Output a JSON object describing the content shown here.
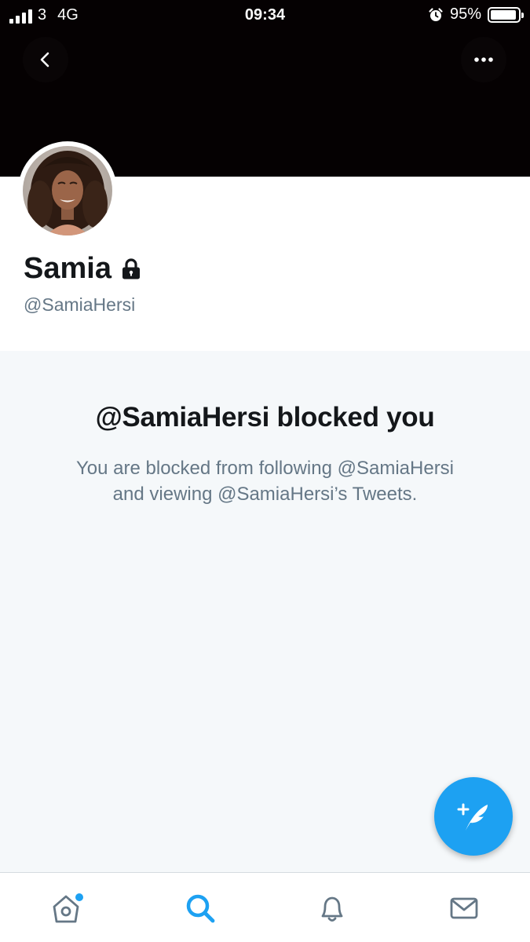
{
  "status_bar": {
    "carrier": "3",
    "network": "4G",
    "time": "09:34",
    "battery_percent": "95%",
    "battery_level": 0.95,
    "icons": [
      "signal-icon",
      "alarm-icon",
      "battery-icon"
    ]
  },
  "header": {
    "back_icon": "chevron-left-icon",
    "more_icon": "more-horizontal-icon"
  },
  "profile": {
    "name": "Samia",
    "handle": "@SamiaHersi",
    "protected_icon": "lock-icon"
  },
  "blocked_notice": {
    "title": "@SamiaHersi blocked you",
    "line1": "You are blocked from following @SamiaHersi",
    "line2": "and viewing @SamiaHersi’s Tweets."
  },
  "compose": {
    "icon": "compose-tweet-icon"
  },
  "tab_bar": {
    "tabs": [
      {
        "name": "home",
        "icon": "home-icon",
        "has_notification_dot": true,
        "active": false
      },
      {
        "name": "search",
        "icon": "search-icon",
        "active": true
      },
      {
        "name": "notifications",
        "icon": "bell-icon",
        "active": false
      },
      {
        "name": "messages",
        "icon": "mail-icon",
        "active": false
      }
    ]
  },
  "colors": {
    "accent": "#1da1f2",
    "banner": "#050102",
    "text_primary": "#14171a",
    "text_secondary": "#657786",
    "background_gray": "#f5f8fa"
  }
}
